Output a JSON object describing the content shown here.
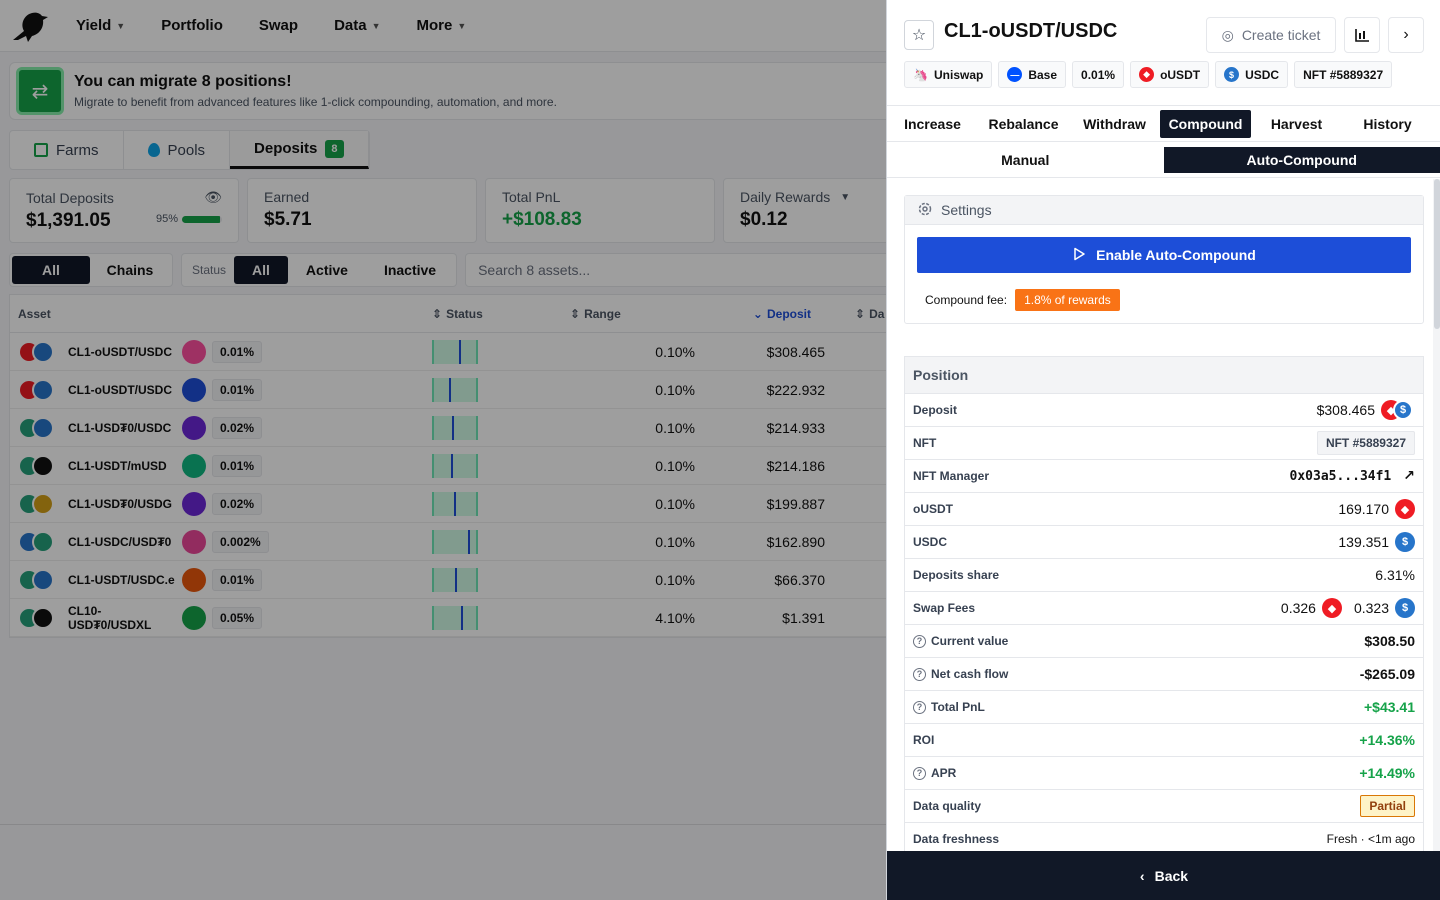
{
  "nav": {
    "items": [
      "Yield",
      "Portfolio",
      "Swap",
      "Data",
      "More"
    ]
  },
  "migrate": {
    "title": "You can migrate 8 positions!",
    "subtitle": "Migrate to benefit from advanced features like 1-click compounding, automation, and more."
  },
  "seg_tabs": {
    "farms": "Farms",
    "pools": "Pools",
    "deposits": "Deposits",
    "deposits_count": "8"
  },
  "stats": {
    "total_deposits_label": "Total Deposits",
    "total_deposits_value": "$1,391.05",
    "total_deposits_pct": "95%",
    "total_deposits_fill": 0.95,
    "earned_label": "Earned",
    "earned_value": "$5.71",
    "pnl_label": "Total PnL",
    "pnl_value": "+$108.83",
    "daily_label": "Daily Rewards",
    "daily_value": "$0.12"
  },
  "filters": {
    "all": "All",
    "chains": "Chains",
    "status_label": "Status",
    "status_all": "All",
    "active": "Active",
    "inactive": "Inactive",
    "search_placeholder": "Search 8 assets..."
  },
  "table": {
    "headers": {
      "asset": "Asset",
      "status": "Status",
      "range": "Range",
      "deposit": "Deposit",
      "da": "Da"
    },
    "rows": [
      {
        "pair": "CL1-oUSDT/USDC",
        "fee": "0.01%",
        "range": "0.10%",
        "deposit": "$308.465",
        "pos": 0.6
      },
      {
        "pair": "CL1-oUSDT/USDC",
        "fee": "0.01%",
        "range": "0.10%",
        "deposit": "$222.932",
        "pos": 0.35
      },
      {
        "pair": "CL1-USD₮0/USDC",
        "fee": "0.02%",
        "range": "0.10%",
        "deposit": "$214.933",
        "pos": 0.42
      },
      {
        "pair": "CL1-USDT/mUSD",
        "fee": "0.01%",
        "range": "0.10%",
        "deposit": "$214.186",
        "pos": 0.4
      },
      {
        "pair": "CL1-USD₮0/USDG",
        "fee": "0.02%",
        "range": "0.10%",
        "deposit": "$199.887",
        "pos": 0.48
      },
      {
        "pair": "CL1-USDC/USD₮0",
        "fee": "0.002%",
        "range": "0.10%",
        "deposit": "$162.890",
        "pos": 0.82
      },
      {
        "pair": "CL1-USDT/USDC.e",
        "fee": "0.01%",
        "range": "0.10%",
        "deposit": "$66.370",
        "pos": 0.5
      },
      {
        "pair": "CL10-USD₮0/USDXL",
        "fee": "0.05%",
        "range": "4.10%",
        "deposit": "$1.391",
        "pos": 0.64
      }
    ]
  },
  "drawer": {
    "title": "CL1-oUSDT/USDC",
    "create_ticket": "Create ticket",
    "chips": {
      "dex": "Uniswap",
      "chain": "Base",
      "fee": "0.01%",
      "token0": "oUSDT",
      "token1": "USDC",
      "nft": "NFT #5889327"
    },
    "action_tabs": [
      "Increase",
      "Rebalance",
      "Withdraw",
      "Compound",
      "Harvest",
      "History"
    ],
    "mode_tabs": [
      "Manual",
      "Auto-Compound"
    ],
    "settings": {
      "title": "Settings",
      "enable_button": "Enable Auto-Compound",
      "fee_label": "Compound fee:",
      "fee_value": "1.8% of rewards"
    },
    "position": {
      "title": "Position",
      "deposit_label": "Deposit",
      "deposit_value": "$308.465",
      "nft_label": "NFT",
      "nft_value": "NFT #5889327",
      "nft_manager_label": "NFT Manager",
      "nft_manager_value": "0x03a5...34f1",
      "ousdt_label": "oUSDT",
      "ousdt_value": "169.170",
      "usdc_label": "USDC",
      "usdc_value": "139.351",
      "share_label": "Deposits share",
      "share_value": "6.31%",
      "swap_fees_label": "Swap Fees",
      "swap_fee0": "0.326",
      "swap_fee1": "0.323",
      "current_value_label": "Current value",
      "current_value": "$308.50",
      "net_cash_label": "Net cash flow",
      "net_cash_value": "-$265.09",
      "total_pnl_label": "Total PnL",
      "total_pnl_value": "+$43.41",
      "roi_label": "ROI",
      "roi_value": "+14.36%",
      "apr_label": "APR",
      "apr_value": "+14.49%",
      "quality_label": "Data quality",
      "quality_value": "Partial",
      "freshness_label": "Data freshness",
      "freshness_value": "Fresh · <1m ago"
    },
    "back": "Back"
  },
  "colors": {
    "accent_blue": "#1d4ed8",
    "positive_green": "#16a34a",
    "dark": "#111827",
    "orange": "#f97316"
  }
}
